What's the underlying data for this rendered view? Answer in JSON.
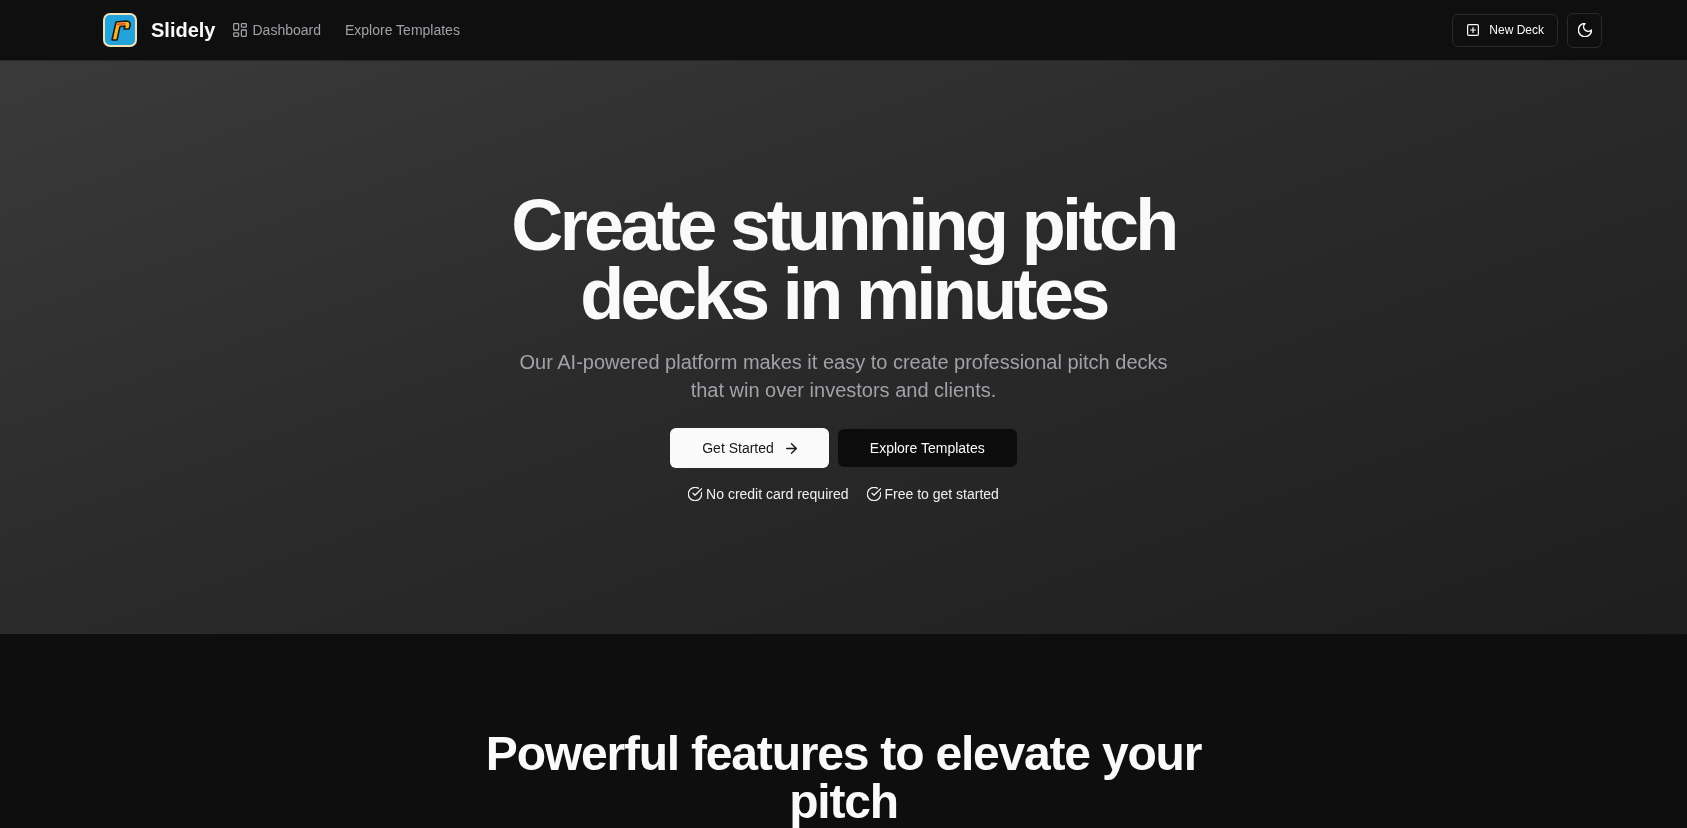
{
  "header": {
    "brand": "Slidely",
    "nav": [
      {
        "kind": "icon",
        "label": "Dashboard"
      },
      {
        "kind": "text",
        "label": "Explore Templates"
      }
    ],
    "new_deck": {
      "label": "New Deck"
    }
  },
  "hero": {
    "title": "Create stunning pitch decks in minutes",
    "subtitle": "Our AI-powered platform makes it easy to create professional pitch decks that win over investors and clients.",
    "buttons": [
      {
        "kind": "primary",
        "label": "Get Started"
      },
      {
        "kind": "secondary",
        "label": "Explore Templates"
      }
    ],
    "perks": [
      "No credit card required",
      "Free to get started"
    ]
  },
  "features": {
    "title": "Powerful features to elevate your pitch"
  }
}
